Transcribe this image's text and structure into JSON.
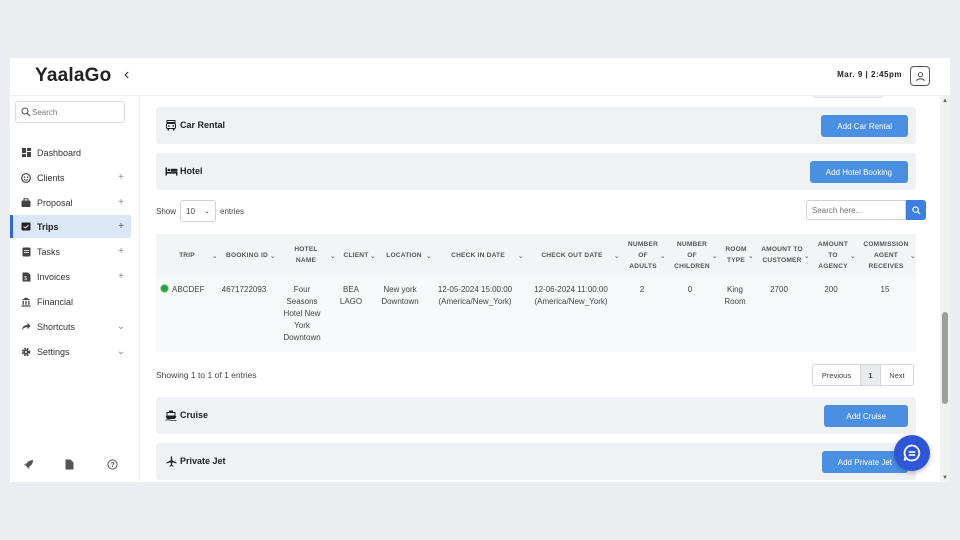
{
  "app": {
    "logo": "YaalaGo",
    "collapse_glyph": "‹",
    "datetime": "Mar. 9 | 2:45pm"
  },
  "sidebar": {
    "search_placeholder": "Search",
    "items": [
      {
        "label": "Dashboard",
        "icon": "dashboard-icon",
        "tail": ""
      },
      {
        "label": "Clients",
        "icon": "clients-icon",
        "tail": "+"
      },
      {
        "label": "Proposal",
        "icon": "proposal-icon",
        "tail": "+"
      },
      {
        "label": "Trips",
        "icon": "trips-icon",
        "tail": "+",
        "active": true
      },
      {
        "label": "Tasks",
        "icon": "tasks-icon",
        "tail": "+"
      },
      {
        "label": "Invoices",
        "icon": "invoices-icon",
        "tail": "+"
      },
      {
        "label": "Financial",
        "icon": "bank-icon",
        "tail": ""
      },
      {
        "label": "Shortcuts",
        "icon": "shortcut-icon",
        "tail": "⌄"
      },
      {
        "label": "Settings",
        "icon": "gear-icon",
        "tail": "⌄"
      }
    ],
    "footer_icons": [
      "rocket-icon",
      "document-icon",
      "help-icon"
    ]
  },
  "sections": {
    "car_rental": {
      "title": "Car Rental",
      "button": "Add Car Rental"
    },
    "hotel": {
      "title": "Hotel",
      "button": "Add Hotel Booking"
    },
    "cruise": {
      "title": "Cruise",
      "button": "Add Cruise"
    },
    "private_jet": {
      "title": "Private Jet",
      "button": "Add Private Jet"
    }
  },
  "table": {
    "show_label": "Show",
    "entries_value": "10",
    "entries_label": "entries",
    "search_placeholder": "Search here...",
    "columns": [
      "TRIP",
      "BOOKING ID",
      "HOTEL NAME",
      "CLIENT",
      "LOCATION",
      "CHECK IN DATE",
      "CHECK OUT DATE",
      "NUMBER OF ADULTS",
      "NUMBER OF CHILDREN",
      "ROOM TYPE",
      "AMOUNT TO CUSTOMER",
      "AMOUNT TO AGENCY",
      "COMMISSION AGENT RECEIVES"
    ],
    "rows": [
      {
        "trip": "ABCDEF",
        "booking_id": "4671722093",
        "hotel_name": "Four Seasons Hotel New York Downtown",
        "client": "BEA LAGO",
        "location": "New york Downtown",
        "check_in": "12-05-2024 15:00:00 (America/New_York)",
        "check_out": "12-06-2024 11:00:00 (America/New_York)",
        "adults": "2",
        "children": "0",
        "room_type": "King Room",
        "amount_customer": "2700",
        "amount_agency": "200",
        "commission": "15"
      }
    ],
    "info": "Showing 1 to 1 of 1 entries",
    "pagination": {
      "prev": "Previous",
      "page": "1",
      "next": "Next"
    }
  },
  "colors": {
    "primary_button": "#4a90e2",
    "active_nav": "#dbe6f7",
    "fab": "#2f56d8",
    "status_green": "#2e9e44"
  }
}
